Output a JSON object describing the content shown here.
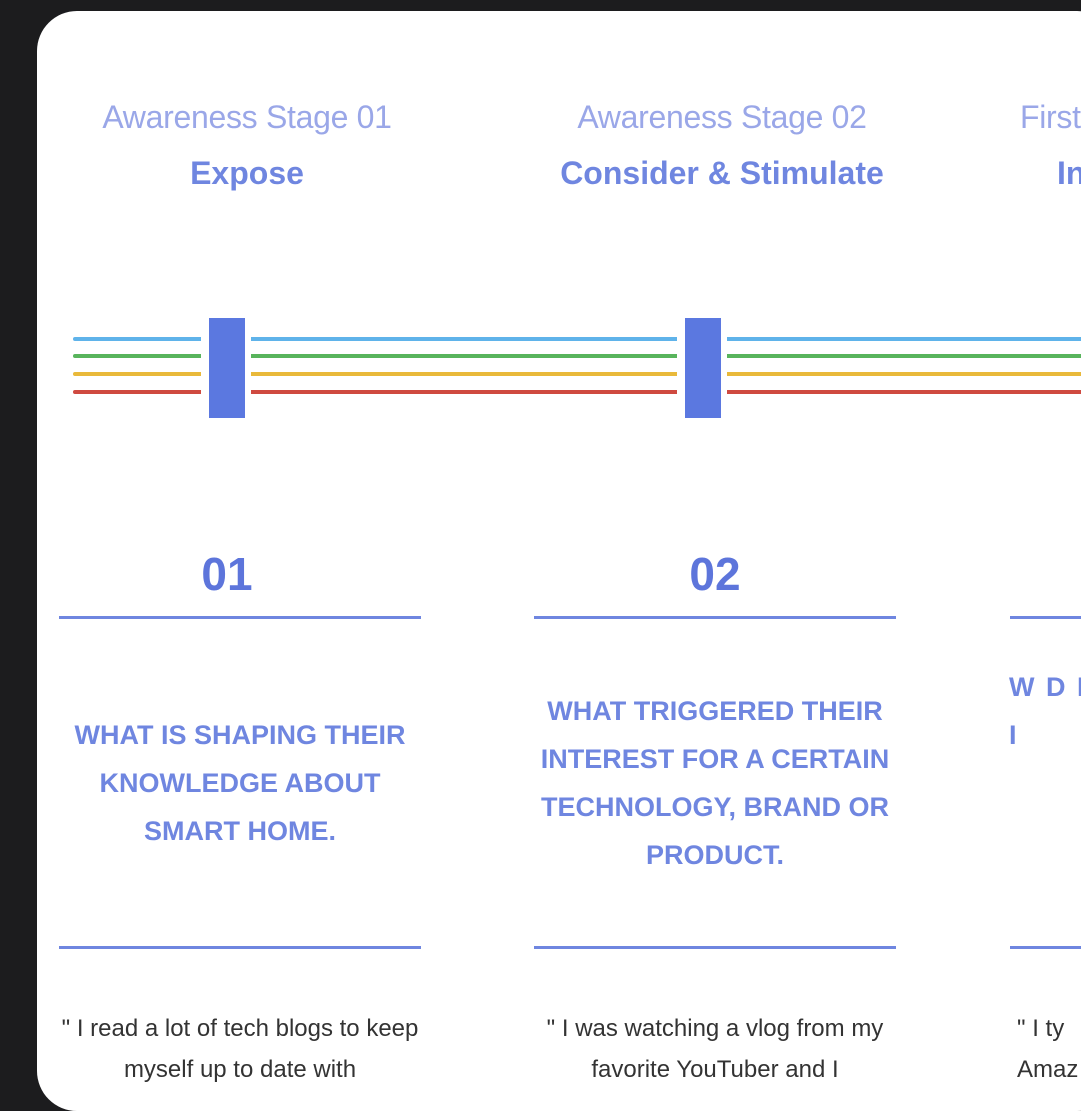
{
  "stages": [
    {
      "label": "Awareness Stage 01",
      "name": "Expose",
      "number": "01",
      "question": "WHAT IS SHAPING THEIR KNOWLEDGE ABOUT SMART HOME.",
      "quote": "\" I read a lot of tech blogs to keep myself up to date with"
    },
    {
      "label": "Awareness Stage 02",
      "name": "Consider & Stimulate",
      "number": "02",
      "question": "WHAT TRIGGERED THEIR INTEREST FOR A CERTAIN TECHNOLOGY, BRAND OR PRODUCT.",
      "quote": "\" I was watching a vlog from my favorite YouTuber and I"
    },
    {
      "label": "First",
      "name": "In",
      "number": "",
      "question": "W D EX TO I",
      "quote": "\" I ty Amaz"
    }
  ],
  "colors": {
    "accent": "#5b78e0",
    "line_blue": "#4aa8e8",
    "line_green": "#4caf50",
    "line_yellow": "#e8b830",
    "line_red": "#d0443a"
  }
}
